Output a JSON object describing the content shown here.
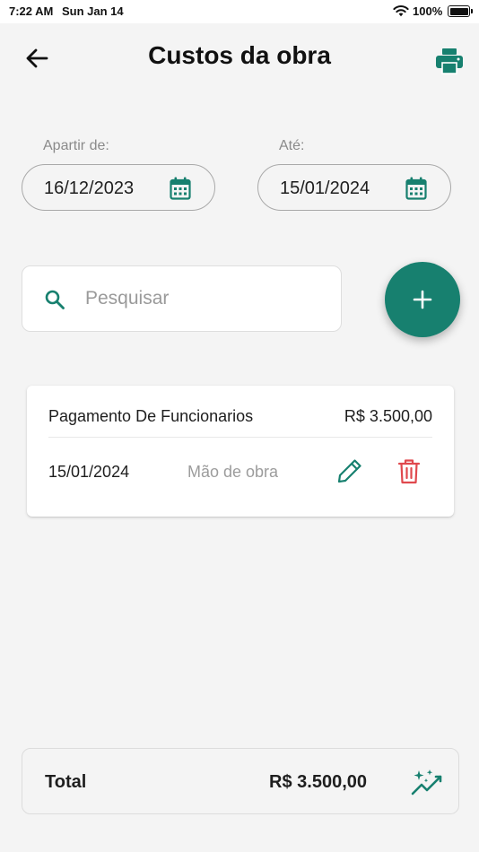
{
  "status_bar": {
    "time": "7:22 AM",
    "date": "Sun Jan 14",
    "battery": "100%",
    "battery_level": 100
  },
  "header": {
    "title": "Custos da obra",
    "back_icon": "arrow-left-icon",
    "print_icon": "printer-icon"
  },
  "filters": {
    "from_label": "Apartir de:",
    "from_value": "16/12/2023",
    "to_label": "Até:",
    "to_value": "15/01/2024",
    "calendar_icon": "calendar-icon"
  },
  "search": {
    "placeholder": "Pesquisar",
    "value": ""
  },
  "costs": [
    {
      "description": "Pagamento De Funcionarios",
      "amount": "R$ 3.500,00",
      "date": "15/01/2024",
      "category": "Mão de obra"
    }
  ],
  "total": {
    "label": "Total",
    "value": "R$ 3.500,00",
    "icon": "sparkle-chart-icon"
  },
  "colors": {
    "accent": "#17806f",
    "delete": "#e0494e",
    "background": "#f4f4f4",
    "card": "#ffffff",
    "muted_text": "#9c9c9c"
  }
}
